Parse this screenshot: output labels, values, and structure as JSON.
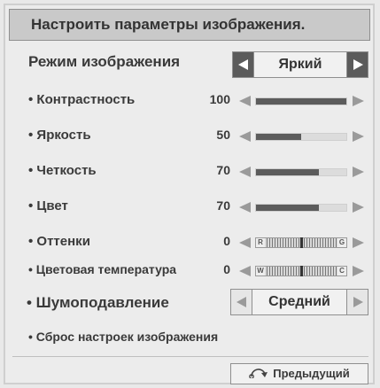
{
  "header": {
    "title": "Настроить параметры изображения."
  },
  "picture_mode": {
    "label": "Режим изображения",
    "value": "Яркий"
  },
  "sliders": [
    {
      "label": "• Контрастность",
      "value": "100",
      "level": 1.0
    },
    {
      "label": "• Яркость",
      "value": "50",
      "level": 0.5
    },
    {
      "label": "• Четкость",
      "value": "70",
      "level": 0.7
    },
    {
      "label": "• Цвет",
      "value": "70",
      "level": 0.7
    }
  ],
  "balance_sliders": [
    {
      "label": "• Оттенки",
      "value": "0",
      "left_cap": "R",
      "right_cap": "G"
    },
    {
      "label": "• Цветовая температура",
      "value": "0",
      "left_cap": "W",
      "right_cap": "C"
    }
  ],
  "noise_reduction": {
    "label": "• Шумоподавление",
    "value": "Средний"
  },
  "reset": {
    "label": "• Сброс настроек изображения"
  },
  "footer": {
    "prev_label": "Предыдущий",
    "prev_icon": "return-icon"
  },
  "colors": {
    "fill": "#5c5c5c",
    "selected_arrows": "#5b5b5b"
  }
}
